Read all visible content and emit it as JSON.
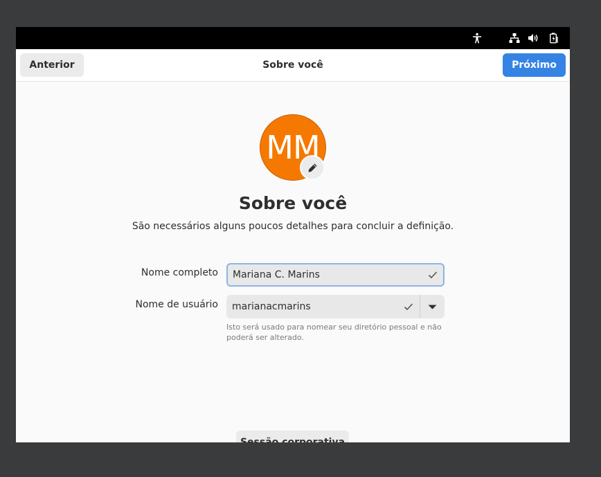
{
  "header": {
    "back_label": "Anterior",
    "title": "Sobre você",
    "next_label": "Próximo"
  },
  "topbar": {
    "icons": [
      "accessibility-icon",
      "network-icon",
      "volume-icon",
      "battery-icon"
    ]
  },
  "avatar": {
    "initials": "MM",
    "color": "#f57900"
  },
  "page": {
    "title": "Sobre você",
    "subtitle": "São necessários alguns poucos detalhes para concluir a definição."
  },
  "form": {
    "fullname_label": "Nome completo",
    "fullname_value": "Mariana C. Marins",
    "username_label": "Nome de usuário",
    "username_value": "marianacmarins",
    "username_hint": "Isto será usado para nomear seu diretório pessoal e não poderá ser alterado."
  },
  "enterprise_button_label": "Sessão corporativa",
  "colors": {
    "accent": "#3584e4",
    "focus_ring": "#8ab4e6"
  }
}
